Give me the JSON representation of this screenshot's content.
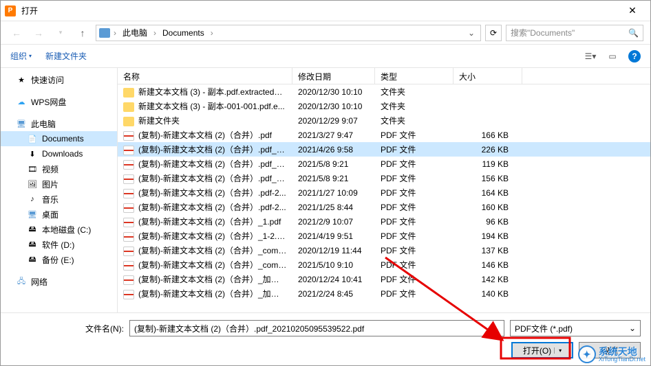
{
  "title": "打开",
  "breadcrumb": {
    "root": "此电脑",
    "folder": "Documents"
  },
  "search": {
    "placeholder": "搜索\"Documents\""
  },
  "toolbar": {
    "organize": "组织",
    "newfolder": "新建文件夹"
  },
  "columns": {
    "name": "名称",
    "date": "修改日期",
    "type": "类型",
    "size": "大小"
  },
  "sidebar": {
    "quick": "快速访问",
    "wps": "WPS网盘",
    "pc": "此电脑",
    "documents": "Documents",
    "downloads": "Downloads",
    "videos": "视频",
    "pictures": "图片",
    "music": "音乐",
    "desktop": "桌面",
    "drive_c": "本地磁盘 (C:)",
    "drive_d": "软件 (D:)",
    "drive_e": "备份 (E:)",
    "network": "网络"
  },
  "files": [
    {
      "icon": "folder",
      "name": "新建文本文档 (3) - 副本.pdf.extracted_i...",
      "date": "2020/12/30 10:10",
      "type": "文件夹",
      "size": "",
      "selected": false
    },
    {
      "icon": "folder",
      "name": "新建文本文档 (3) - 副本-001-001.pdf.e...",
      "date": "2020/12/30 10:10",
      "type": "文件夹",
      "size": "",
      "selected": false
    },
    {
      "icon": "folder",
      "name": "新建文件夹",
      "date": "2020/12/29 9:07",
      "type": "文件夹",
      "size": "",
      "selected": false
    },
    {
      "icon": "pdf",
      "name": "(复制)-新建文本文档 (2)（合并）.pdf",
      "date": "2021/3/27 9:47",
      "type": "PDF 文件",
      "size": "166 KB",
      "selected": false
    },
    {
      "icon": "pdf",
      "name": "(复制)-新建文本文档 (2)（合并）.pdf_2...",
      "date": "2021/4/26 9:58",
      "type": "PDF 文件",
      "size": "226 KB",
      "selected": true
    },
    {
      "icon": "pdf",
      "name": "(复制)-新建文本文档 (2)（合并）.pdf_2...",
      "date": "2021/5/8 9:21",
      "type": "PDF 文件",
      "size": "119 KB",
      "selected": false
    },
    {
      "icon": "pdf",
      "name": "(复制)-新建文本文档 (2)（合并）.pdf_2...",
      "date": "2021/5/8 9:21",
      "type": "PDF 文件",
      "size": "156 KB",
      "selected": false
    },
    {
      "icon": "pdf",
      "name": "(复制)-新建文本文档 (2)（合并）.pdf-2...",
      "date": "2021/1/27 10:09",
      "type": "PDF 文件",
      "size": "164 KB",
      "selected": false
    },
    {
      "icon": "pdf",
      "name": "(复制)-新建文本文档 (2)（合并）.pdf-2...",
      "date": "2021/1/25 8:44",
      "type": "PDF 文件",
      "size": "160 KB",
      "selected": false
    },
    {
      "icon": "pdf",
      "name": "(复制)-新建文本文档 (2)（合并）_1.pdf",
      "date": "2021/2/9 10:07",
      "type": "PDF 文件",
      "size": "96 KB",
      "selected": false
    },
    {
      "icon": "pdf",
      "name": "(复制)-新建文本文档 (2)（合并）_1-2.pdf",
      "date": "2021/4/19 9:51",
      "type": "PDF 文件",
      "size": "194 KB",
      "selected": false
    },
    {
      "icon": "pdf",
      "name": "(复制)-新建文本文档 (2)（合并）_comp...",
      "date": "2020/12/19 11:44",
      "type": "PDF 文件",
      "size": "137 KB",
      "selected": false
    },
    {
      "icon": "pdf",
      "name": "(复制)-新建文本文档 (2)（合并）_comp...",
      "date": "2021/5/10 9:10",
      "type": "PDF 文件",
      "size": "146 KB",
      "selected": false
    },
    {
      "icon": "pdf",
      "name": "(复制)-新建文本文档 (2)（合并）_加密.p...",
      "date": "2020/12/24 10:41",
      "type": "PDF 文件",
      "size": "142 KB",
      "selected": false
    },
    {
      "icon": "pdf",
      "name": "(复制)-新建文本文档 (2)（合并）_加密.p...",
      "date": "2021/2/24 8:45",
      "type": "PDF 文件",
      "size": "140 KB",
      "selected": false
    }
  ],
  "footer": {
    "filename_label": "文件名(N):",
    "filename_value": "(复制)-新建文本文档 (2)（合并）.pdf_20210205095539522.pdf",
    "filetype": "PDF文件 (*.pdf)",
    "open": "打开(O)",
    "cancel": "取消"
  },
  "watermark": {
    "cn": "系统天地",
    "en": "XiTongTianDi.net"
  }
}
